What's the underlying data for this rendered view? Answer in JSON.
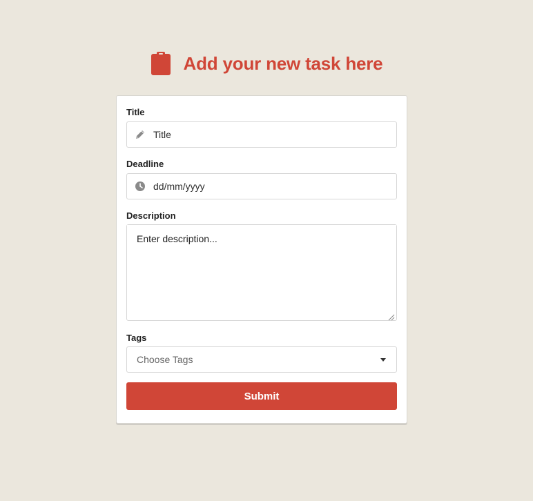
{
  "header": {
    "title": "Add your new task here",
    "icon": "clipboard-icon"
  },
  "form": {
    "title_label": "Title",
    "title_placeholder": "Title",
    "title_icon": "pencil-icon",
    "deadline_label": "Deadline",
    "deadline_placeholder": "dd/mm/yyyy",
    "deadline_icon": "clock-icon",
    "description_label": "Description",
    "description_placeholder": "Enter description...",
    "tags_label": "Tags",
    "tags_placeholder": "Choose Tags",
    "submit_label": "Submit"
  },
  "colors": {
    "background": "#ebe7dd",
    "accent": "#d04637",
    "card": "#ffffff"
  }
}
